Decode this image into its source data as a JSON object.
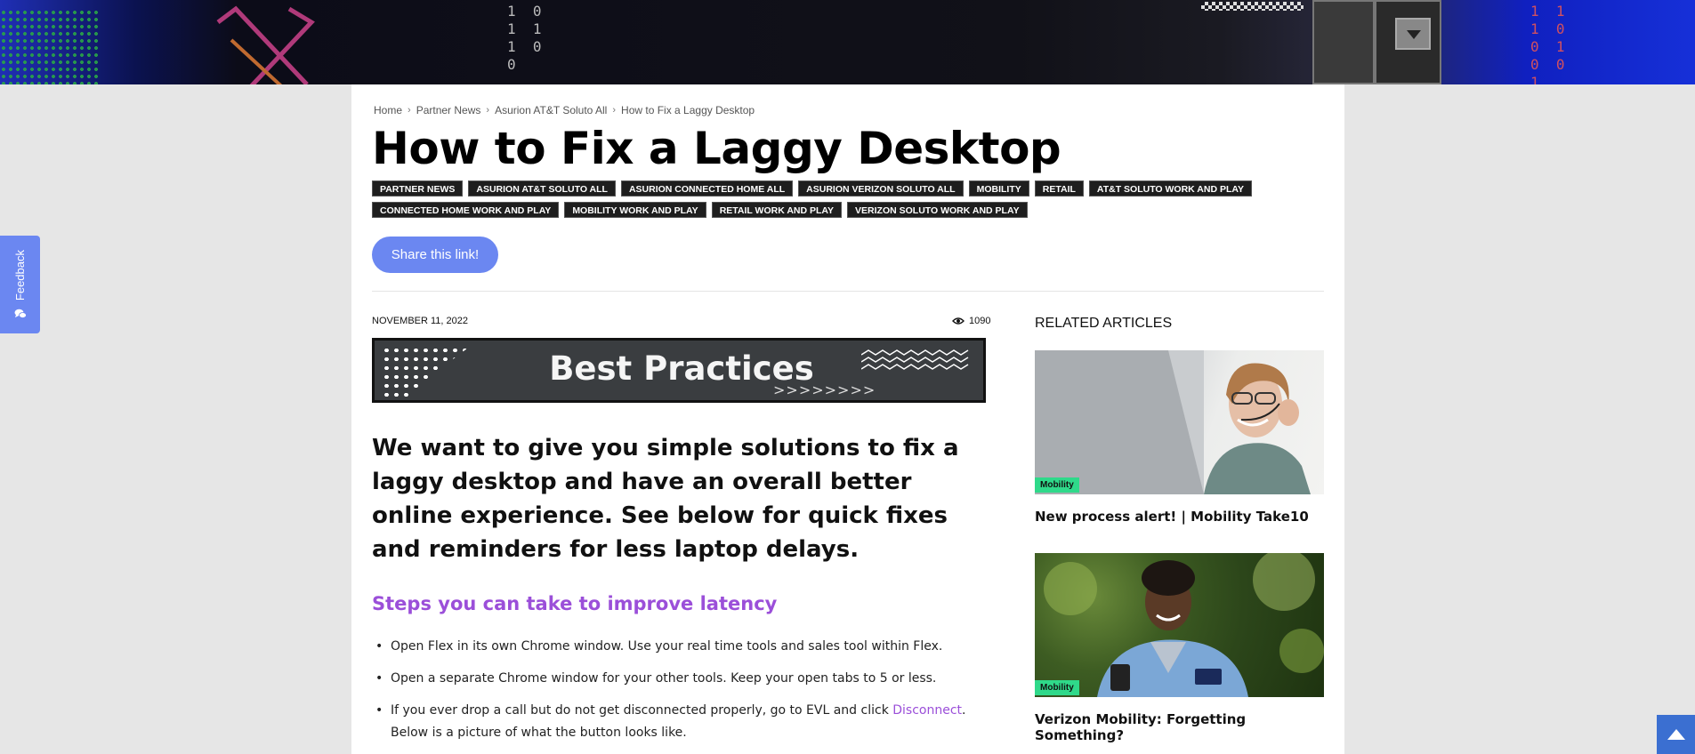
{
  "breadcrumb": [
    "Home",
    "Partner News",
    "Asurion AT&T Soluto All",
    "How to Fix a Laggy Desktop"
  ],
  "banner": {
    "binary_left": "1  0\n1  1\n1  0\n0",
    "binary_right": "1  1\n1  0\n0  1\n0  0\n1"
  },
  "page_title": "How to Fix a Laggy Desktop",
  "tags": [
    "PARTNER NEWS",
    "ASURION AT&T SOLUTO ALL",
    "ASURION CONNECTED HOME ALL",
    "ASURION VERIZON SOLUTO ALL",
    "MOBILITY",
    "RETAIL",
    "AT&T SOLUTO WORK AND PLAY",
    "CONNECTED HOME WORK AND PLAY",
    "MOBILITY WORK AND PLAY",
    "RETAIL WORK AND PLAY",
    "VERIZON SOLUTO WORK AND PLAY"
  ],
  "share_label": "Share this link!",
  "article": {
    "date": "NOVEMBER 11, 2022",
    "views": "1090",
    "hero_title": "Best Practices",
    "hero_arrows": ">>>>>>>>",
    "lead": "We want to give you simple solutions to fix a laggy desktop and have an overall better online experience. See below for quick fixes and reminders for less laptop delays.",
    "subhead": "Steps you can take to improve latency",
    "steps": [
      "Open Flex in its own Chrome window. Use your real time tools and sales tool within Flex.",
      "Open a separate Chrome window for your other tools. Keep your open tabs to 5 or less."
    ],
    "step3": {
      "before": "If you ever drop a call but do not get disconnected properly, go to EVL and click ",
      "link": "Disconnect",
      "after": ". Below is a picture of what the button looks like."
    }
  },
  "sidebar": {
    "title": "RELATED ARTICLES",
    "cards": [
      {
        "badge": "Mobility",
        "title": "New process alert! | Mobility Take10"
      },
      {
        "badge": "Mobility",
        "title": "Verizon Mobility: Forgetting Something?"
      }
    ]
  },
  "feedback_label": "Feedback",
  "colors": {
    "accent": "#6b87f1",
    "purple": "#9b4fd9",
    "badge": "#2fd98a",
    "tag_bg": "#1e1e1e"
  }
}
